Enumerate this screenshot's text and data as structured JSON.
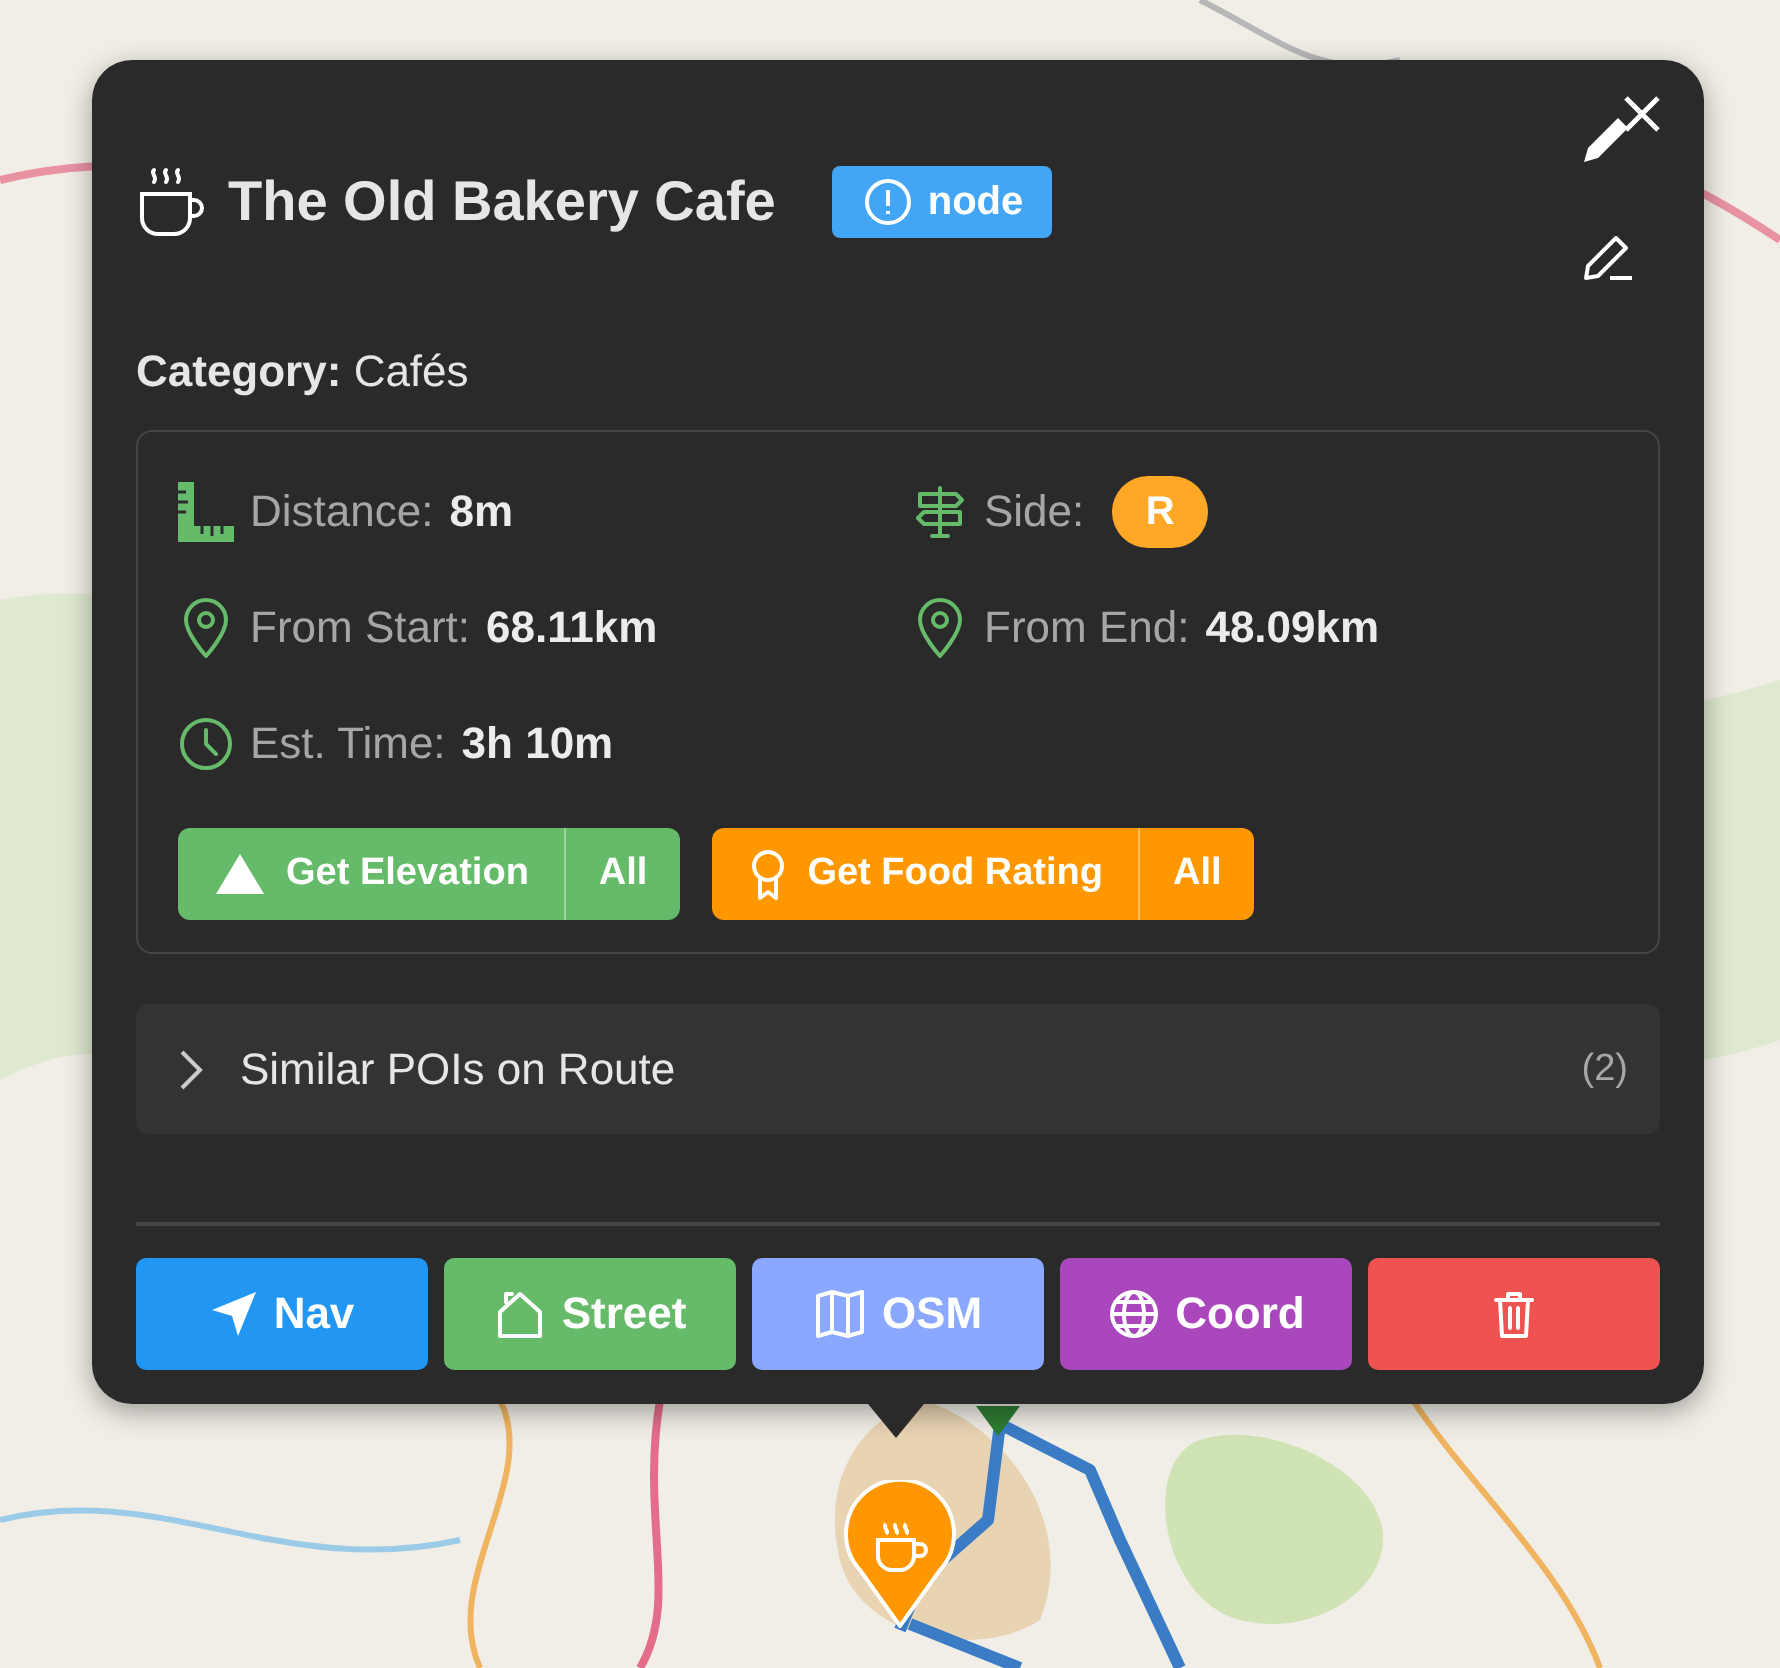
{
  "title": "The Old Bakery Cafe",
  "badge": "node",
  "category": {
    "label": "Category:",
    "value": "Cafés"
  },
  "details": [
    {
      "kind": "distance",
      "label": "Distance:",
      "value": "8m"
    },
    {
      "kind": "side",
      "label": "Side:",
      "value": "R"
    },
    {
      "kind": "start",
      "label": "From Start:",
      "value": "68.11km"
    },
    {
      "kind": "end",
      "label": "From End:",
      "value": "48.09km"
    },
    {
      "kind": "time",
      "label": "Est. Time:",
      "value": "3h 10m"
    }
  ],
  "actions": [
    {
      "kind": "elevation",
      "label": "Get Elevation",
      "secondary": "All",
      "color": "#66bb6a"
    },
    {
      "kind": "rating",
      "label": "Get Food Rating",
      "secondary": "All",
      "color": "#ff9800"
    }
  ],
  "similar": {
    "label": "Similar POIs on Route",
    "count": "(2)",
    "expanded": false
  },
  "buttons": [
    {
      "kind": "nav",
      "label": "Nav",
      "color": "#2196f3"
    },
    {
      "kind": "street",
      "label": "Street",
      "color": "#66bb6a"
    },
    {
      "kind": "osm",
      "label": "OSM",
      "color": "#8aa8ff"
    },
    {
      "kind": "coord",
      "label": "Coord",
      "color": "#ab47bc"
    },
    {
      "kind": "delete",
      "color": "#ef5350"
    }
  ]
}
